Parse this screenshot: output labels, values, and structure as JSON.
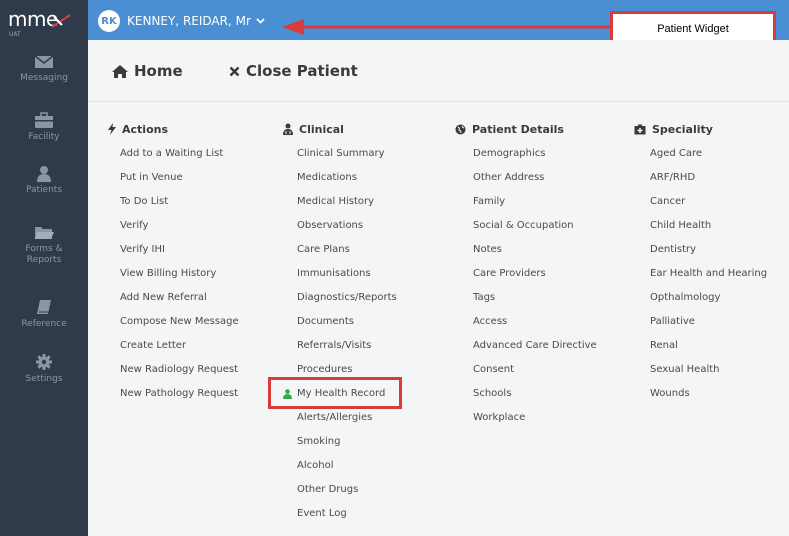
{
  "sidebar": {
    "logo_text": "mme",
    "logo_sub": "UAT",
    "items": [
      {
        "label": "Messaging",
        "icon": "envelope-icon"
      },
      {
        "label": "Facility",
        "icon": "briefcase-icon"
      },
      {
        "label": "Patients",
        "icon": "person-icon"
      },
      {
        "label": "Forms & Reports",
        "icon": "folder-icon"
      },
      {
        "label": "Reference",
        "icon": "book-icon"
      },
      {
        "label": "Settings",
        "icon": "gear-icon"
      }
    ]
  },
  "topbar": {
    "initials": "RK",
    "patient_name": "KENNEY, REIDAR, Mr"
  },
  "annotation": {
    "callout_text": "Patient Widget",
    "color": "#d93a3a"
  },
  "header": {
    "home_label": "Home",
    "close_label": "Close Patient"
  },
  "columns": [
    {
      "title": "Actions",
      "icon": "bolt-icon",
      "items": [
        "Add to a Waiting List",
        "Put in Venue",
        "To Do List",
        "Verify",
        "Verify IHI",
        "View Billing History",
        "Add New Referral",
        "Compose New Message",
        "Create Letter",
        "New Radiology Request",
        "New Pathology Request"
      ]
    },
    {
      "title": "Clinical",
      "icon": "stethoscope-icon",
      "items": [
        "Clinical Summary",
        "Medications",
        "Medical History",
        "Observations",
        "Care Plans",
        "Immunisations",
        "Diagnostics/Reports",
        "Documents",
        "Referrals/Visits",
        "Procedures",
        "My Health Record",
        "Alerts/Allergies",
        "Smoking",
        "Alcohol",
        "Other Drugs",
        "Event Log"
      ]
    },
    {
      "title": "Patient Details",
      "icon": "globe-icon",
      "items": [
        "Demographics",
        "Other Address",
        "Family",
        "Social & Occupation",
        "Notes",
        "Care Providers",
        "Tags",
        "Access",
        "Advanced Care Directive",
        "Consent",
        "Schools",
        "Workplace"
      ]
    },
    {
      "title": "Speciality",
      "icon": "hospital-icon",
      "items": [
        "Aged Care",
        "ARF/RHD",
        "Cancer",
        "Child Health",
        "Dentistry",
        "Ear Health and Hearing",
        "Opthalmology",
        "Palliative",
        "Renal",
        "Sexual Health",
        "Wounds"
      ]
    }
  ],
  "colors": {
    "sidebar": "#2f3b4a",
    "topbar": "#4a8fd4",
    "mhr_icon": "#3aa84a"
  }
}
